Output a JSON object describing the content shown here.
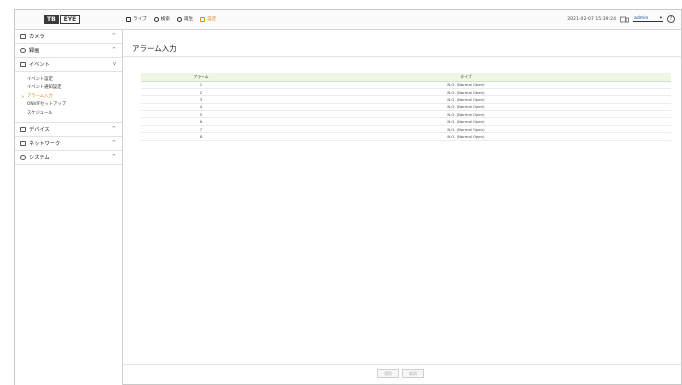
{
  "header": {
    "logo_box": "TB",
    "logo_word": "EYE",
    "menu": [
      {
        "label": "ライブ",
        "icon": "monitor-icon"
      },
      {
        "label": "検索",
        "icon": "search-icon"
      },
      {
        "label": "再生",
        "icon": "playback-icon"
      },
      {
        "label": "設定",
        "icon": "settings-icon",
        "active": true
      }
    ],
    "datetime": "2021-02-07 15:39:24",
    "user": "admin",
    "user_arrow": "▾",
    "help": "?"
  },
  "sidebar": {
    "sections": [
      {
        "label": "カメラ",
        "chevron": "^"
      },
      {
        "label": "録画",
        "chevron": "^"
      },
      {
        "label": "イベント",
        "chevron": "v"
      },
      {
        "label": "デバイス",
        "chevron": "^"
      },
      {
        "label": "ネットワーク",
        "chevron": "^"
      },
      {
        "label": "システム",
        "chevron": "^"
      }
    ],
    "event_items": [
      {
        "label": "イベント設定"
      },
      {
        "label": "イベント通知設定"
      },
      {
        "label": "アラーム入力",
        "active": true
      },
      {
        "label": "ONVIFセットアップ"
      },
      {
        "label": "スケジュール"
      }
    ]
  },
  "main": {
    "title": "アラーム入力",
    "table": {
      "headers": [
        "アラーム",
        "タイプ"
      ],
      "rows": [
        [
          "1",
          "N.O. (Normal Open)"
        ],
        [
          "2",
          "N.O. (Normal Open)"
        ],
        [
          "3",
          "N.O. (Normal Open)"
        ],
        [
          "4",
          "N.O. (Normal Open)"
        ],
        [
          "5",
          "N.O. (Normal Open)"
        ],
        [
          "6",
          "N.O. (Normal Open)"
        ],
        [
          "7",
          "N.O. (Normal Open)"
        ],
        [
          "8",
          "N.O. (Normal Open)"
        ]
      ]
    },
    "buttons": {
      "apply": "適用",
      "cancel": "取消"
    }
  },
  "colors": {
    "accent": "#e08a2a",
    "table_header": "#eef6e4",
    "user": "#1a4fa0"
  }
}
